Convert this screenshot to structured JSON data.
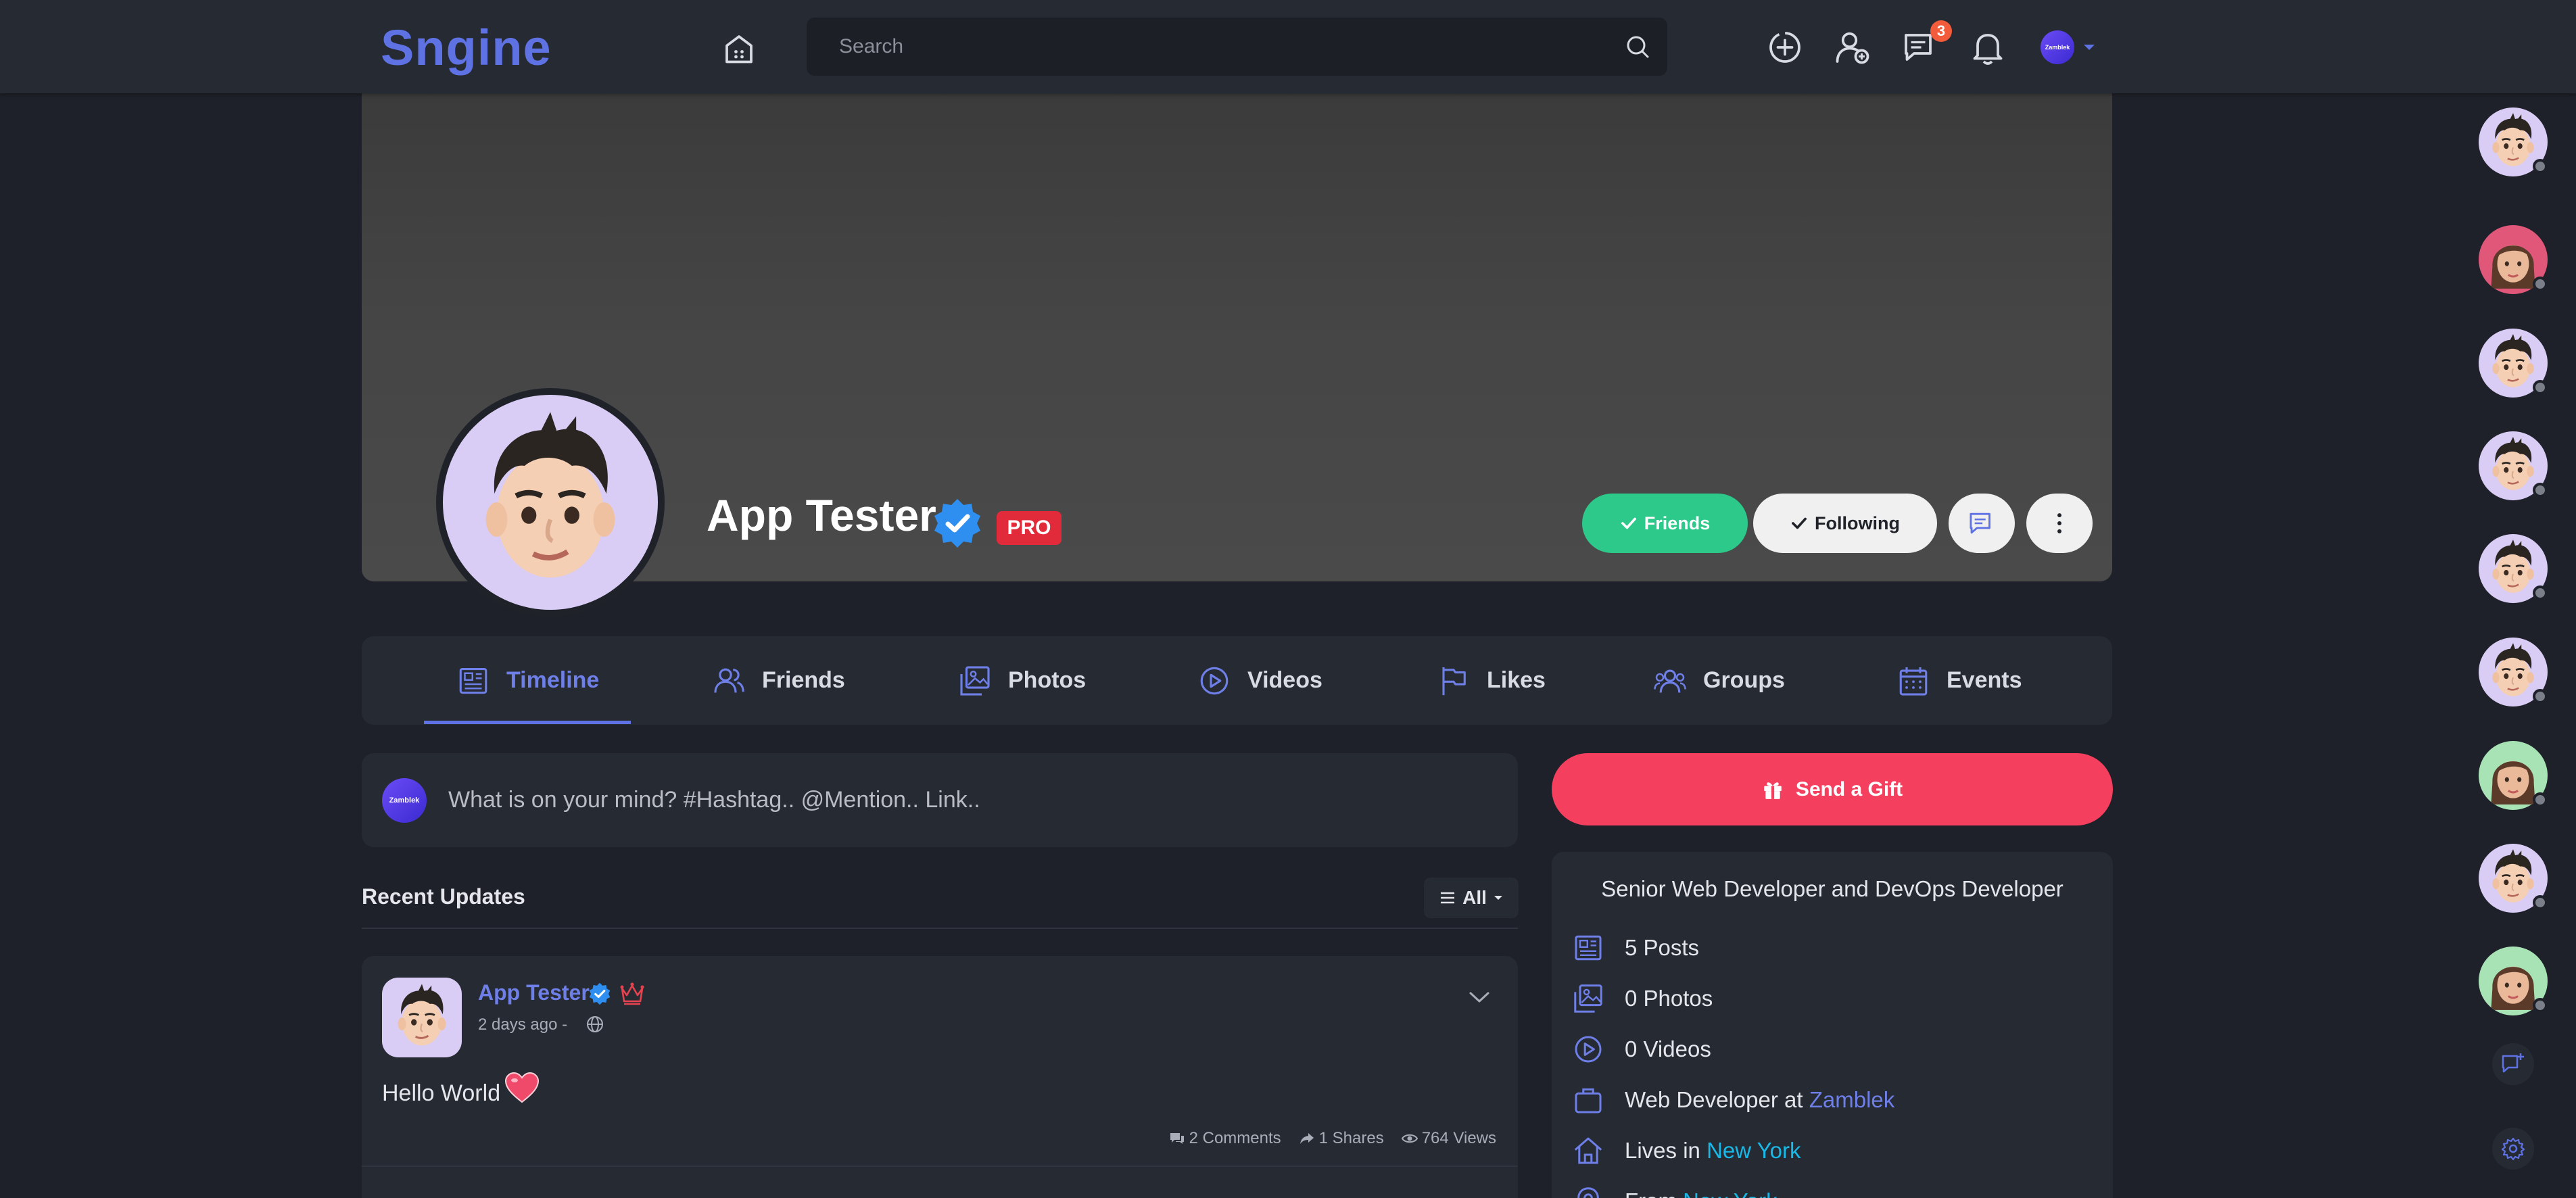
{
  "app": {
    "logo": "Sngine"
  },
  "search": {
    "placeholder": "Search"
  },
  "topbar": {
    "messages_badge": "3",
    "avatar_label": "Zamblek"
  },
  "profile": {
    "name": "App Tester",
    "pro_label": "PRO",
    "friends_button": "Friends",
    "following_button": "Following"
  },
  "tabs": [
    {
      "label": "Timeline",
      "icon": "newspaper-icon"
    },
    {
      "label": "Friends",
      "icon": "users-icon"
    },
    {
      "label": "Photos",
      "icon": "photos-icon"
    },
    {
      "label": "Videos",
      "icon": "video-icon"
    },
    {
      "label": "Likes",
      "icon": "flag-icon"
    },
    {
      "label": "Groups",
      "icon": "groups-icon"
    },
    {
      "label": "Events",
      "icon": "calendar-icon"
    }
  ],
  "composer": {
    "avatar_label": "Zamblek",
    "placeholder": "What is on your mind? #Hashtag.. @Mention.. Link.."
  },
  "feed": {
    "title": "Recent Updates",
    "filter_label": "All"
  },
  "post": {
    "author": "App Tester",
    "time": "2 days ago -",
    "text": "Hello World",
    "comments": "2 Comments",
    "shares": "1 Shares",
    "views": "764 Views"
  },
  "gift": {
    "label": "Send a Gift"
  },
  "about": {
    "headline": "Senior Web Developer and DevOps Developer",
    "posts": "5 Posts",
    "photos": "0 Photos",
    "videos": "0 Videos",
    "work_prefix": "Web Developer at",
    "work_company": "Zamblek",
    "lives_prefix": "Lives in",
    "lives_city": "New York",
    "from_prefix": "From",
    "from_city": "New York"
  },
  "colors": {
    "brand": "#5e72e4",
    "friends_green": "#2cc98a",
    "gift_red": "#f53f5e",
    "pro_red": "#e22b3a",
    "link_cyan": "#18b9e8"
  }
}
